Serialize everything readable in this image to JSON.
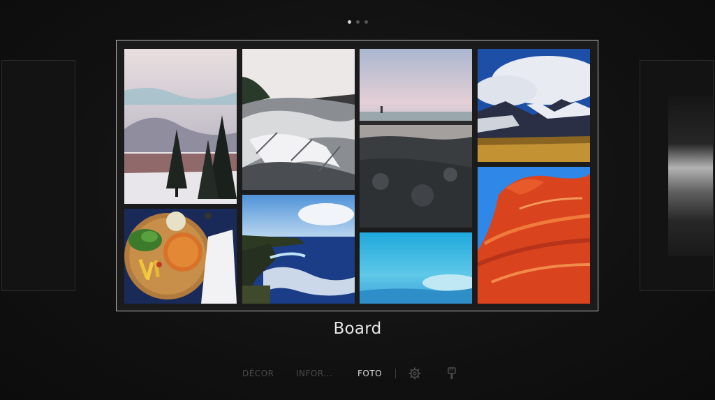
{
  "pagination": {
    "pages": 3,
    "active_index": 0
  },
  "board": {
    "title": "Board"
  },
  "menu": {
    "items": [
      {
        "label": "DÉCOR",
        "active": false
      },
      {
        "label": "INFOR...",
        "active": false
      },
      {
        "label": "FOTO",
        "active": true
      }
    ],
    "icons": [
      "gear-icon",
      "brush-icon"
    ]
  },
  "colors": {
    "background": "#111111",
    "frame": "#b8b8b8",
    "active_text": "#dcdcdc",
    "inactive_text": "#4a4a4a"
  }
}
